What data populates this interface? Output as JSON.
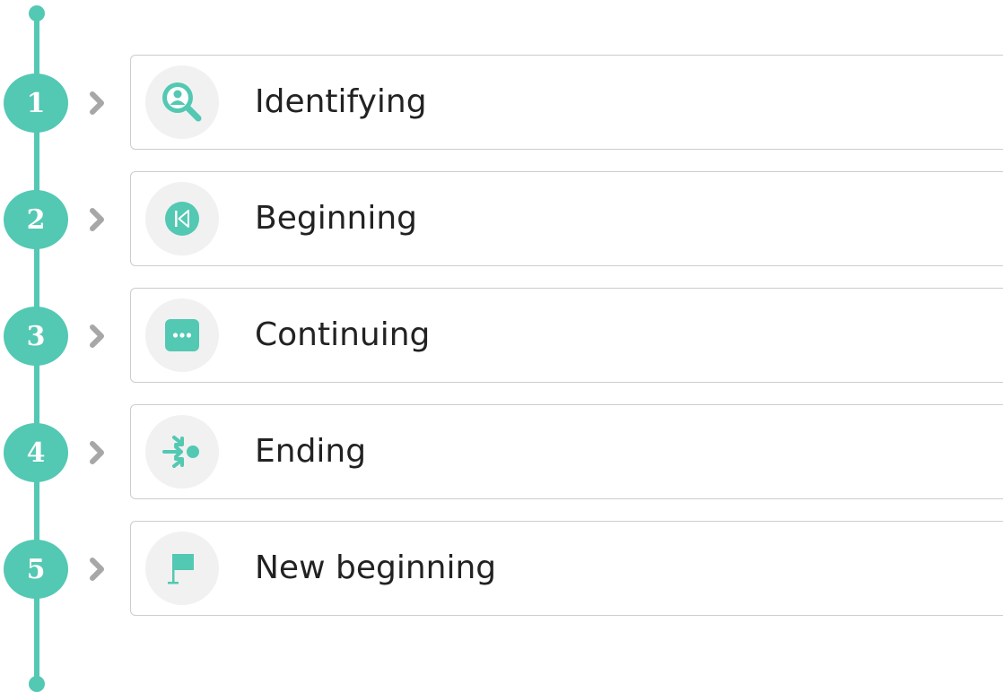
{
  "accent_color": "#53c8b3",
  "steps": [
    {
      "number": "1",
      "label": "Identifying",
      "icon": "search-person-icon"
    },
    {
      "number": "2",
      "label": "Beginning",
      "icon": "skip-back-icon"
    },
    {
      "number": "3",
      "label": "Continuing",
      "icon": "more-dots-icon"
    },
    {
      "number": "4",
      "label": "Ending",
      "icon": "converge-arrows-icon"
    },
    {
      "number": "5",
      "label": "New beginning",
      "icon": "flag-icon"
    }
  ]
}
